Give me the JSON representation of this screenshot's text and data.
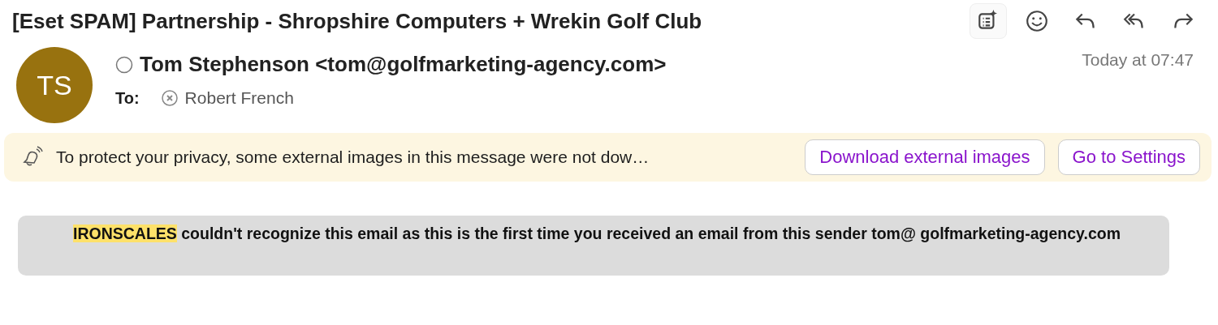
{
  "subject": "[Eset SPAM] Partnership - Shropshire Computers + Wrekin Golf Club",
  "toolbar": [
    {
      "kind": "summary"
    },
    {
      "kind": "emoji"
    },
    {
      "kind": "reply"
    },
    {
      "kind": "reply-all"
    },
    {
      "kind": "forward"
    }
  ],
  "sender": {
    "initials": "TS",
    "color": "#98720f",
    "name": "Tom Stephenson <tom@golfmarketing-agency.com>",
    "time": "Today at 07:47"
  },
  "recipients": {
    "label": "To:",
    "names": [
      "Robert French"
    ]
  },
  "privacy_banner": {
    "text": "To protect your privacy, some external images in this message were not dow…",
    "buttons": [
      "Download external images",
      "Go to Settings"
    ]
  },
  "notice": {
    "highlighted": "IRONSCALES",
    "text": " couldn't recognize this email as this is the first time you received an email from this sender tom@ golfmarketing-agency.com"
  }
}
